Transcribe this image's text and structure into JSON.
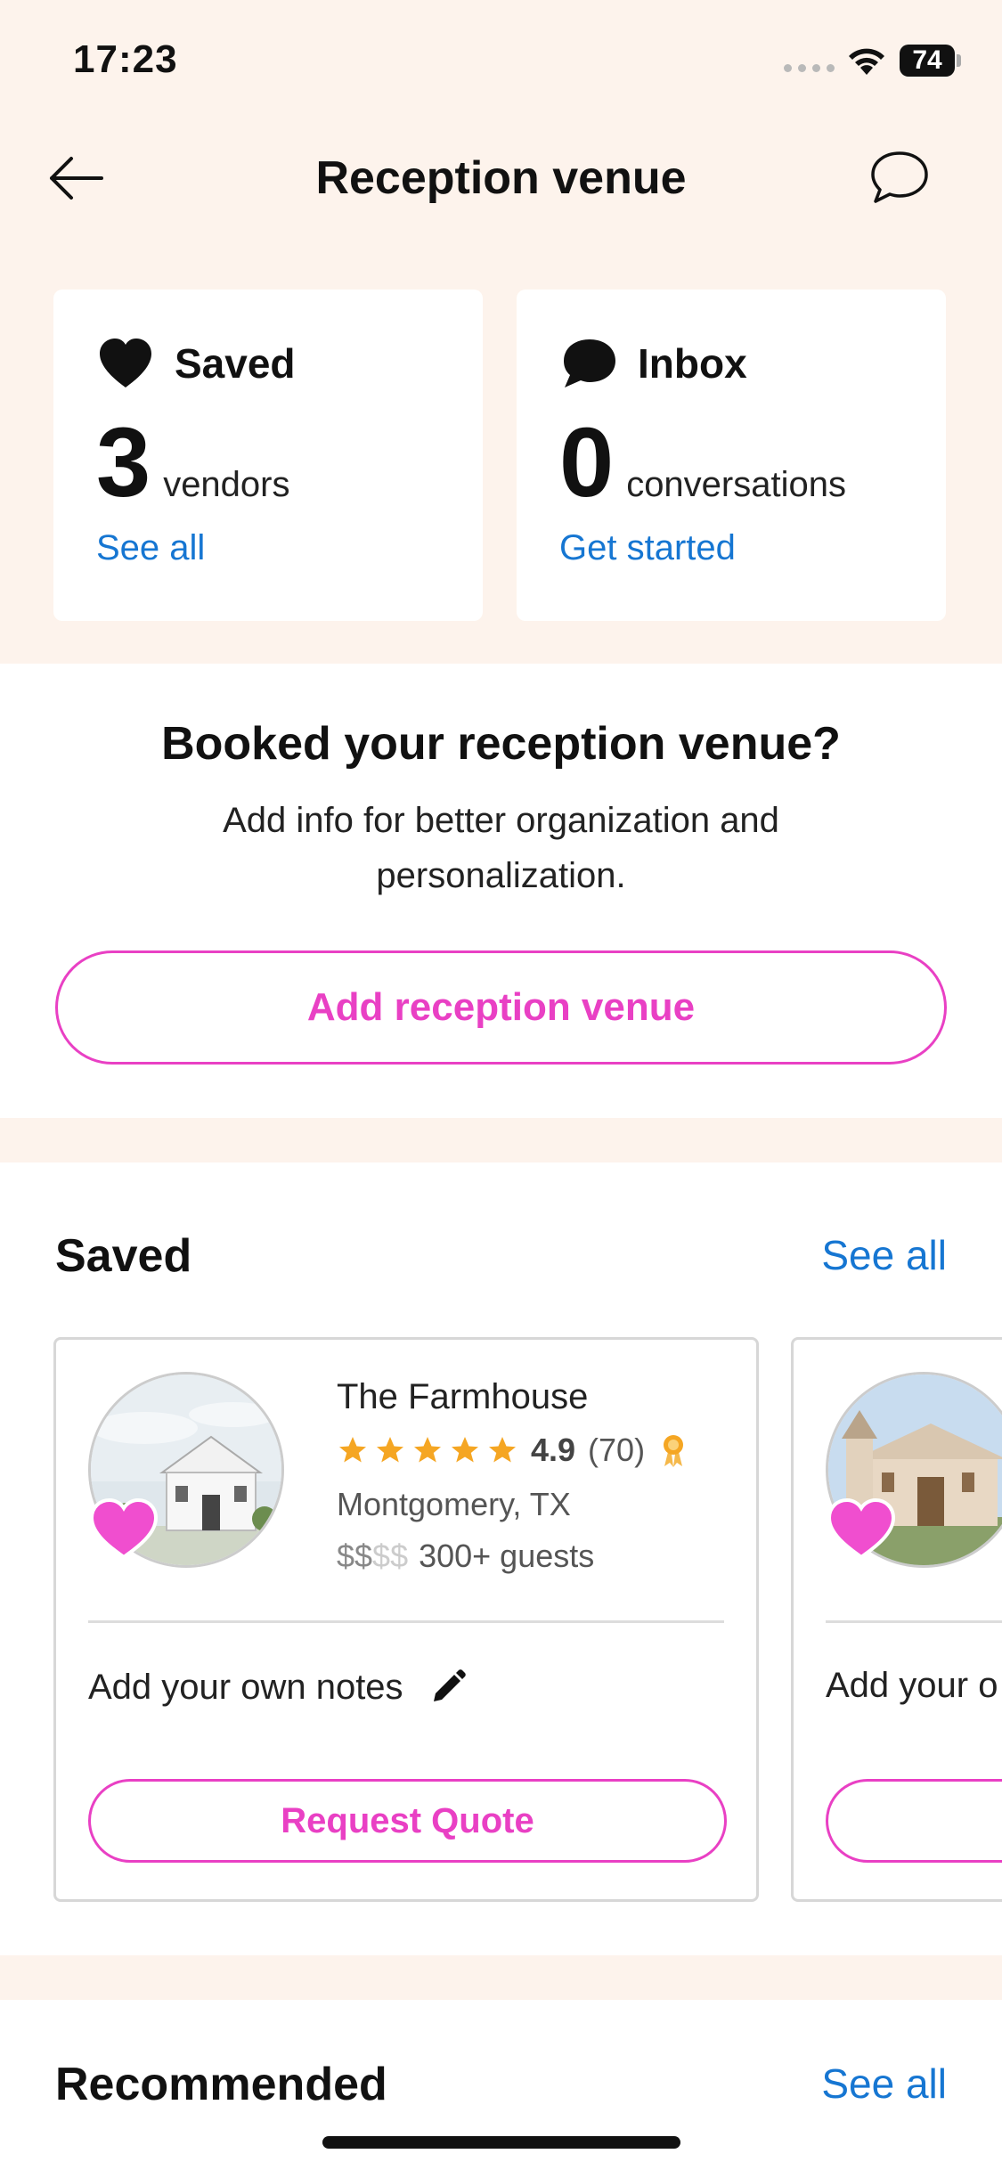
{
  "status_bar": {
    "time": "17:23",
    "battery": "74"
  },
  "nav": {
    "title": "Reception venue"
  },
  "summary": {
    "saved": {
      "title": "Saved",
      "count": "3",
      "unit": "vendors",
      "link": "See all"
    },
    "inbox": {
      "title": "Inbox",
      "count": "0",
      "unit": "conversations",
      "link": "Get started"
    }
  },
  "booked": {
    "title": "Booked your reception venue?",
    "description": "Add info for better organization and personalization.",
    "button": "Add reception venue"
  },
  "saved_section": {
    "title": "Saved",
    "see_all": "See all",
    "vendors": [
      {
        "name": "The Farmhouse",
        "rating": "4.9",
        "reviews": "(70)",
        "stars": 5,
        "location": "Montgomery, TX",
        "price_on": "$$",
        "price_off": "$$",
        "guests": "300+ guests",
        "notes": "Add your own notes",
        "button": "Request Quote"
      },
      {
        "notes": "Add your o"
      }
    ]
  },
  "recommended_section": {
    "title": "Recommended",
    "see_all": "See all"
  },
  "colors": {
    "accent_pink": "#e940c4",
    "link_blue": "#1676d2",
    "background_peach": "#fdf3ec",
    "star": "#f5a623"
  }
}
